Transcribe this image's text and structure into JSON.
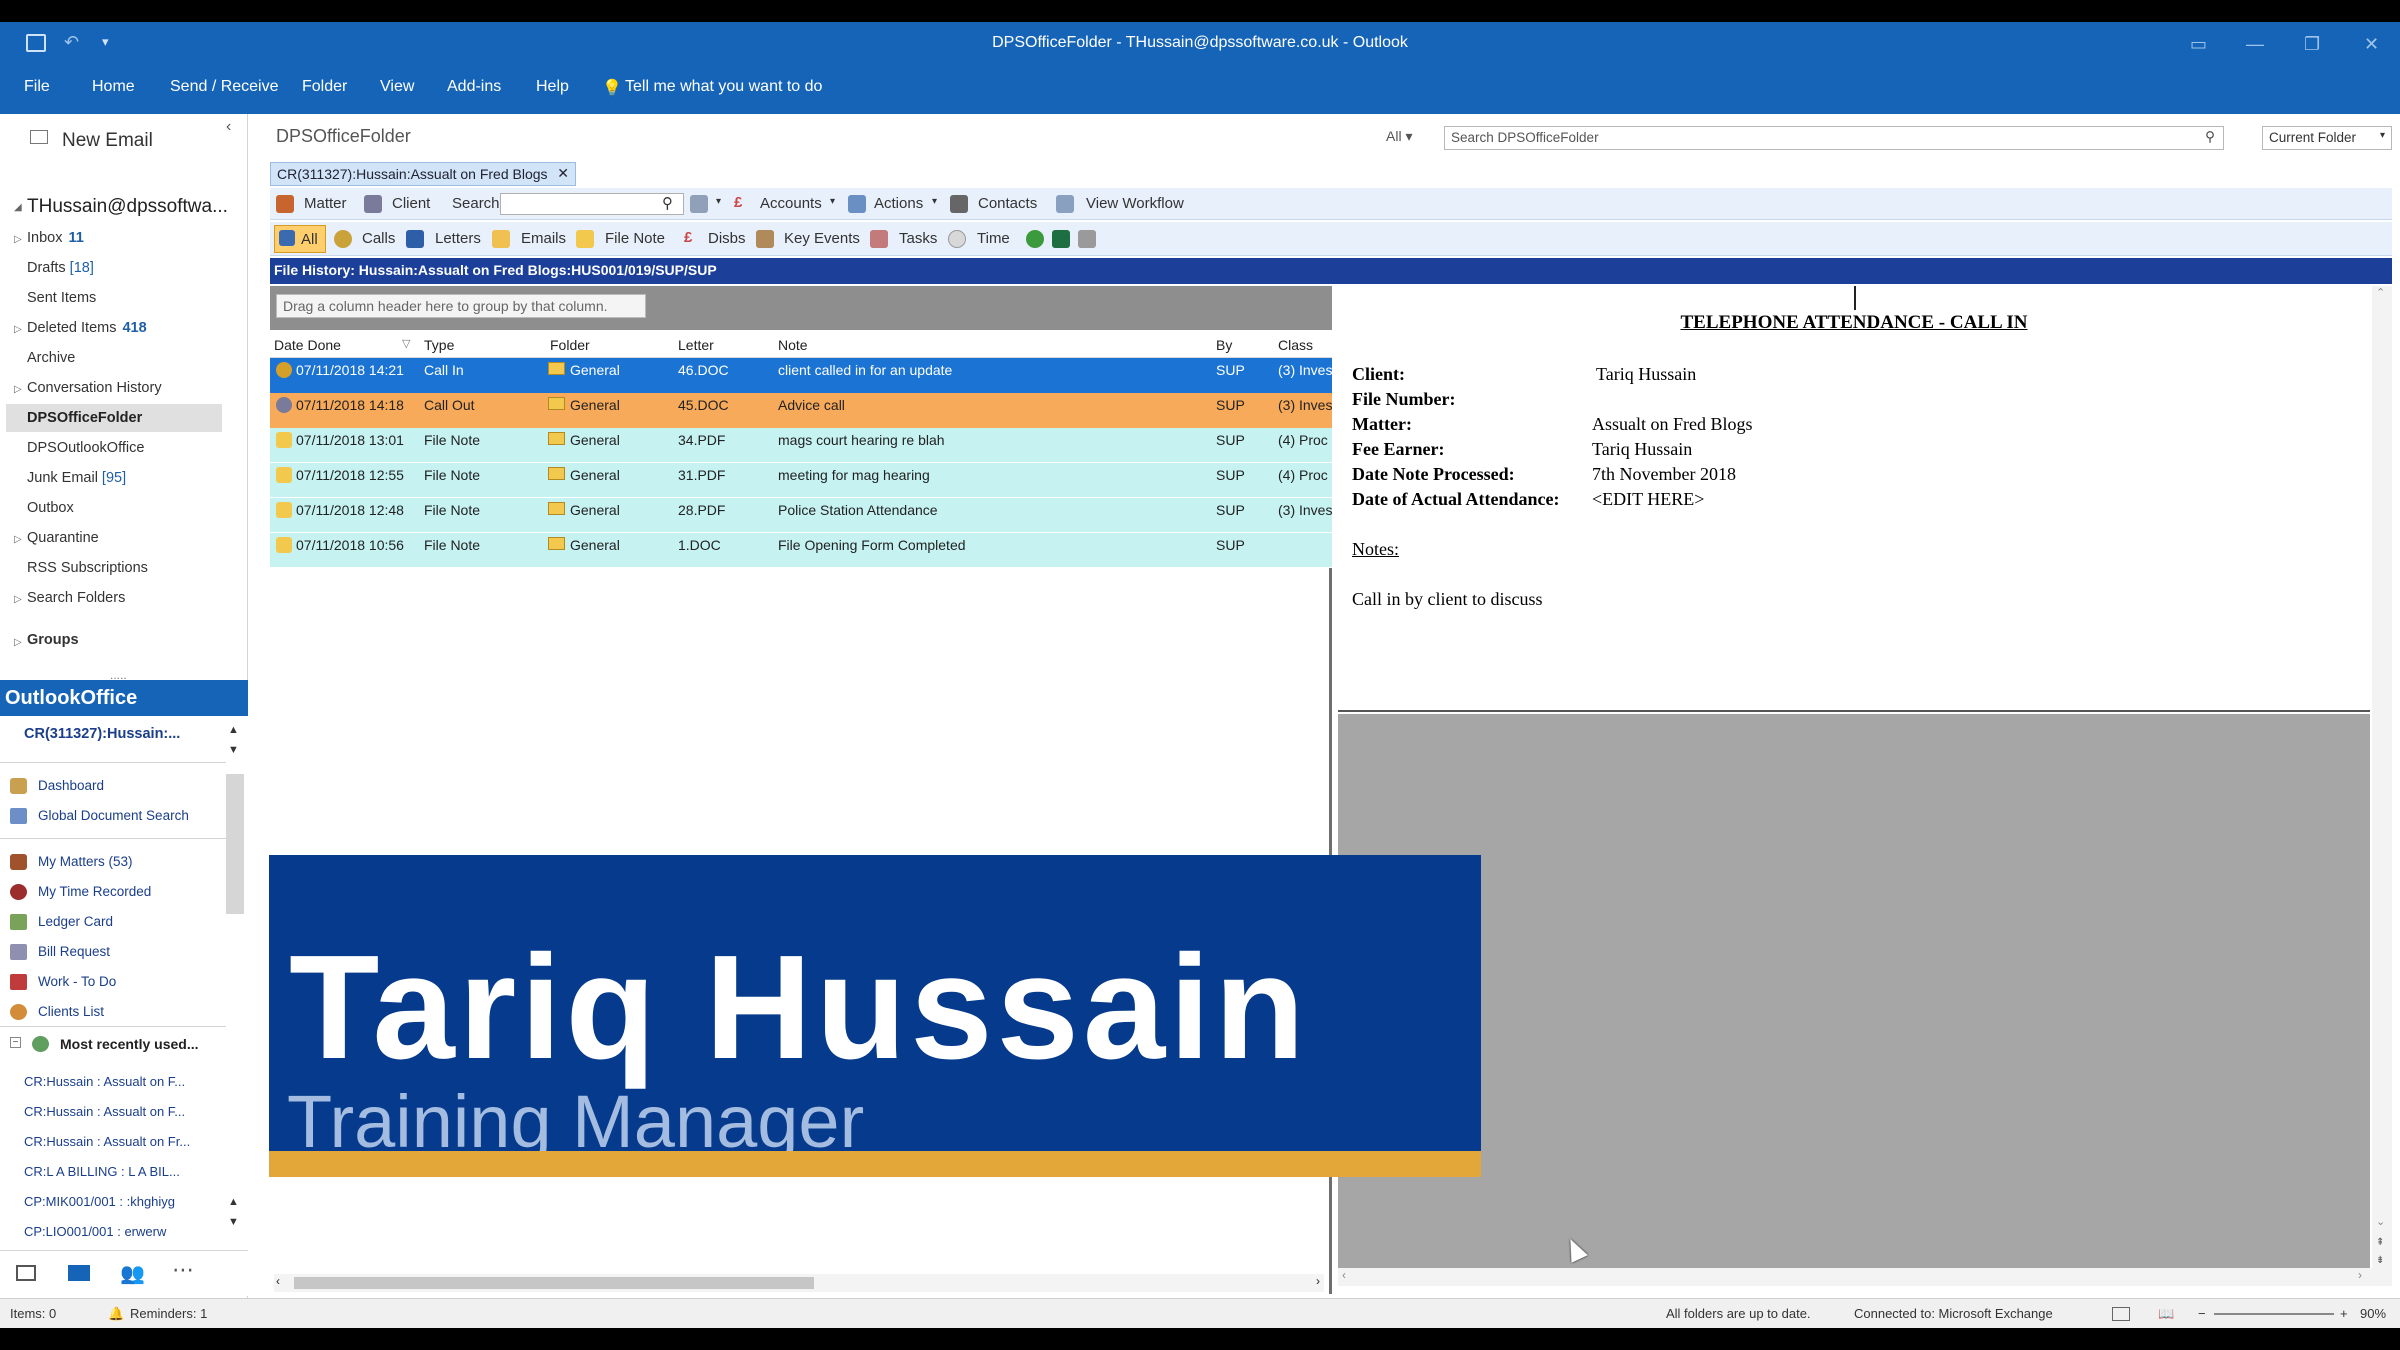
{
  "window": {
    "title": "DPSOfficeFolder - THussain@dpssoftware.co.uk - Outlook"
  },
  "menu": [
    "File",
    "Home",
    "Send / Receive",
    "Folder",
    "View",
    "Add-ins",
    "Help"
  ],
  "tell_me": "Tell me what you want to do",
  "new_email": "New Email",
  "account": "THussain@dpssoftwa...",
  "folders": [
    {
      "label": "Inbox",
      "count": "11"
    },
    {
      "label": "Drafts",
      "count": "[18]"
    },
    {
      "label": "Sent Items"
    },
    {
      "label": "Deleted Items",
      "count": "418"
    },
    {
      "label": "Archive"
    },
    {
      "label": "Conversation History"
    },
    {
      "label": "DPSOfficeFolder"
    },
    {
      "label": "DPSOutlookOffice"
    },
    {
      "label": "Junk Email",
      "count": "[95]"
    },
    {
      "label": "Outbox"
    },
    {
      "label": "Quarantine"
    },
    {
      "label": "RSS Subscriptions"
    },
    {
      "label": "Search Folders"
    },
    {
      "label": "Groups"
    }
  ],
  "outlookoffice": {
    "header": "OutlookOffice",
    "matter": "CR(311327):Hussain:...",
    "links": [
      "Dashboard",
      "Global Document Search",
      "My Matters (53)",
      "My Time Recorded",
      "Ledger Card",
      "Bill Request",
      "Work - To Do",
      "Clients List"
    ],
    "mru_header": "Most recently used...",
    "mru": [
      "CR:Hussain : Assualt on F...",
      "CR:Hussain : Assualt on F...",
      "CR:Hussain : Assualt on Fr...",
      "CR:L A BILLING : L A BIL...",
      "CP:MIK001/001 : :khghiyg",
      "CP:LIO001/001 : erwerw"
    ]
  },
  "breadcrumb": "DPSOfficeFolder",
  "scope": "All",
  "search_placeholder": "Search DPSOfficeFolder",
  "current_folder": "Current Folder",
  "doc_tab": "CR(311327):Hussain:Assualt on Fred Blogs",
  "toolbar1": {
    "matter": "Matter",
    "client": "Client",
    "search": "Search",
    "accounts": "Accounts",
    "actions": "Actions",
    "contacts": "Contacts",
    "workflow": "View Workflow"
  },
  "toolbar2": {
    "all": "All",
    "calls": "Calls",
    "letters": "Letters",
    "emails": "Emails",
    "filenote": "File Note",
    "disbs": "Disbs",
    "keyevents": "Key Events",
    "tasks": "Tasks",
    "time": "Time"
  },
  "file_history": "File History: Hussain:Assualt on Fred Blogs:HUS001/019/SUP/SUP",
  "group_hint": "Drag a column header here to group by that column.",
  "columns": [
    "Date Done",
    "Type",
    "Folder",
    "Letter",
    "Note",
    "By",
    "Class"
  ],
  "rows": [
    {
      "date": "07/11/2018 14:21",
      "type": "Call In",
      "folder": "General",
      "letter": "46.DOC",
      "note": "client called in for an update",
      "by": "SUP",
      "cls": "(3) Inves"
    },
    {
      "date": "07/11/2018 14:18",
      "type": "Call Out",
      "folder": "General",
      "letter": "45.DOC",
      "note": "Advice call",
      "by": "SUP",
      "cls": "(3) Inves"
    },
    {
      "date": "07/11/2018 13:01",
      "type": "File Note",
      "folder": "General",
      "letter": "34.PDF",
      "note": "mags court hearing re blah",
      "by": "SUP",
      "cls": "(4) Proc"
    },
    {
      "date": "07/11/2018 12:55",
      "type": "File Note",
      "folder": "General",
      "letter": "31.PDF",
      "note": "meeting for mag hearing",
      "by": "SUP",
      "cls": "(4) Proc"
    },
    {
      "date": "07/11/2018 12:48",
      "type": "File Note",
      "folder": "General",
      "letter": "28.PDF",
      "note": "Police Station Attendance",
      "by": "SUP",
      "cls": "(3) Inves"
    },
    {
      "date": "07/11/2018 10:56",
      "type": "File Note",
      "folder": "General",
      "letter": "1.DOC",
      "note": "File Opening Form Completed",
      "by": "SUP",
      "cls": ""
    }
  ],
  "preview": {
    "heading": "TELEPHONE ATTENDANCE - CALL IN",
    "client_label": "Client:",
    "client": "Tariq Hussain",
    "filenum_label": "File Number:",
    "matter_label": "Matter:",
    "matter": "Assualt on Fred Blogs",
    "fee_label": "Fee Earner:",
    "fee": "Tariq Hussain",
    "dnp_label": "Date Note Processed:",
    "dnp": "7th November 2018",
    "daa_label": "Date of Actual Attendance:",
    "daa": "<EDIT HERE>",
    "notes_label": "Notes:",
    "notes": "Call in by client to discuss"
  },
  "overlay": {
    "name": "Tariq Hussain",
    "role": "Training Manager"
  },
  "status": {
    "items": "Items: 0",
    "reminders": "Reminders: 1",
    "sync": "All folders are up to date.",
    "connected": "Connected to: Microsoft Exchange",
    "zoom": "90%"
  },
  "colors": {
    "accent": "#1664b8",
    "selected": "#1b74d4",
    "orange": "#f7aa5a",
    "cyan": "#c6f2f2",
    "overlay": "#053a8c",
    "stripe": "#e3a638"
  }
}
